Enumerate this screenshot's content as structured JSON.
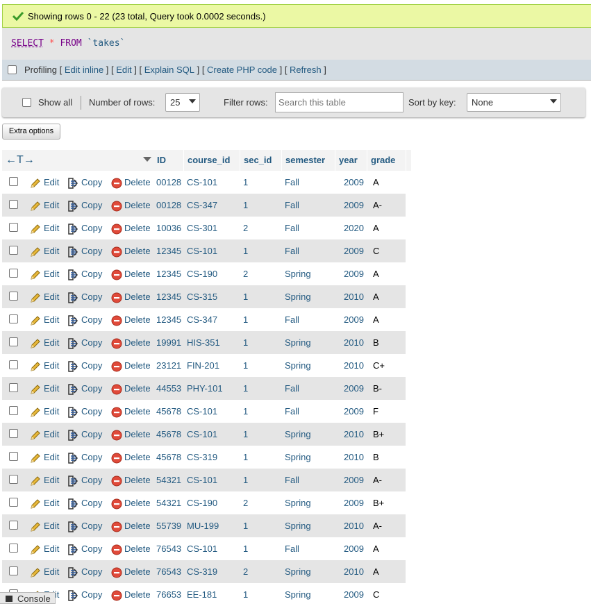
{
  "status": {
    "message": "Showing rows 0 - 22 (23 total, Query took 0.0002 seconds.)"
  },
  "sql": {
    "select": "SELECT",
    "star": "*",
    "from": "FROM",
    "table": "`takes`"
  },
  "profiling": {
    "label": "Profiling",
    "links": [
      "Edit inline",
      "Edit",
      "Explain SQL",
      "Create PHP code",
      "Refresh"
    ]
  },
  "nav": {
    "show_all": "Show all",
    "num_rows_label": "Number of rows:",
    "num_rows_value": "25",
    "filter_label": "Filter rows:",
    "filter_placeholder": "Search this table",
    "sort_label": "Sort by key:",
    "sort_value": "None"
  },
  "extra_options": "Extra options",
  "table": {
    "arrows": "←T→",
    "columns": [
      "ID",
      "course_id",
      "sec_id",
      "semester",
      "year",
      "grade"
    ],
    "action_labels": {
      "edit": "Edit",
      "copy": "Copy",
      "delete": "Delete"
    },
    "rows": [
      [
        "00128",
        "CS-101",
        "1",
        "Fall",
        "2009",
        "A"
      ],
      [
        "00128",
        "CS-347",
        "1",
        "Fall",
        "2009",
        "A-"
      ],
      [
        "10036",
        "CS-301",
        "2",
        "Fall",
        "2020",
        "A"
      ],
      [
        "12345",
        "CS-101",
        "1",
        "Fall",
        "2009",
        "C"
      ],
      [
        "12345",
        "CS-190",
        "2",
        "Spring",
        "2009",
        "A"
      ],
      [
        "12345",
        "CS-315",
        "1",
        "Spring",
        "2010",
        "A"
      ],
      [
        "12345",
        "CS-347",
        "1",
        "Fall",
        "2009",
        "A"
      ],
      [
        "19991",
        "HIS-351",
        "1",
        "Spring",
        "2010",
        "B"
      ],
      [
        "23121",
        "FIN-201",
        "1",
        "Spring",
        "2010",
        "C+"
      ],
      [
        "44553",
        "PHY-101",
        "1",
        "Fall",
        "2009",
        "B-"
      ],
      [
        "45678",
        "CS-101",
        "1",
        "Fall",
        "2009",
        "F"
      ],
      [
        "45678",
        "CS-101",
        "1",
        "Spring",
        "2010",
        "B+"
      ],
      [
        "45678",
        "CS-319",
        "1",
        "Spring",
        "2010",
        "B"
      ],
      [
        "54321",
        "CS-101",
        "1",
        "Fall",
        "2009",
        "A-"
      ],
      [
        "54321",
        "CS-190",
        "2",
        "Spring",
        "2009",
        "B+"
      ],
      [
        "55739",
        "MU-199",
        "1",
        "Spring",
        "2010",
        "A-"
      ],
      [
        "76543",
        "CS-101",
        "1",
        "Fall",
        "2009",
        "A"
      ],
      [
        "76543",
        "CS-319",
        "2",
        "Spring",
        "2010",
        "A"
      ],
      [
        "76653",
        "EE-181",
        "1",
        "Spring",
        "2009",
        "C"
      ]
    ]
  },
  "console": {
    "label": "Console"
  }
}
